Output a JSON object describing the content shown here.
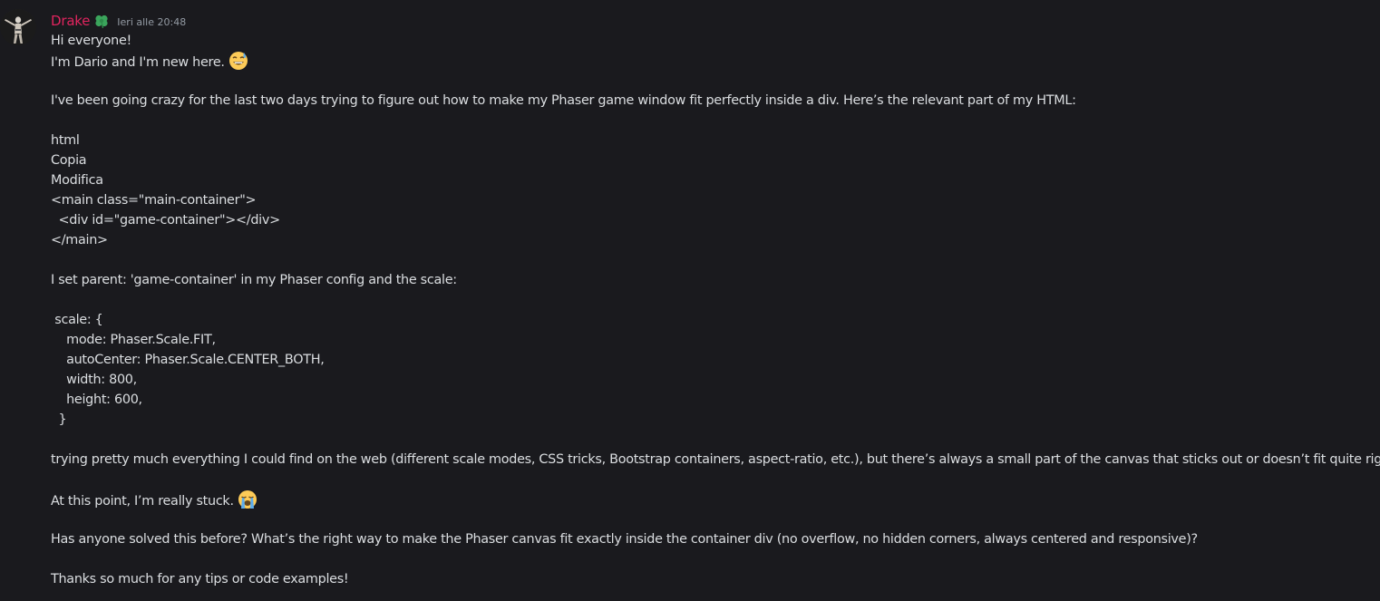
{
  "message": {
    "author": {
      "name": "Drake",
      "name_color": "#e0245e",
      "role_icon": "green-clover-icon",
      "avatar": "avatar-image"
    },
    "timestamp": "Ieri alle 20:48",
    "lines": {
      "l1": "Hi everyone!",
      "l2": "I'm Dario and I'm new here.",
      "l2_emoji": "grinning-sweat-emoji",
      "l4": "I've been going crazy for the last two days trying to figure out how to make my Phaser game window fit perfectly inside a div. Here’s the relevant part of my HTML:",
      "l6": "html",
      "l7": "Copia",
      "l8": "Modifica",
      "l9": "<main class=\"main-container\">",
      "l10": "  <div id=\"game-container\"></div>",
      "l11": "</main>",
      "l13": "I set parent: 'game-container' in my Phaser config and the scale:",
      "l15": " scale: {",
      "l16": "    mode: Phaser.Scale.FIT,",
      "l17": "    autoCenter: Phaser.Scale.CENTER_BOTH,",
      "l18": "    width: 800,",
      "l19": "    height: 600,",
      "l20": "  }",
      "l22": "trying pretty much everything I could find on the web (different scale modes, CSS tricks, Bootstrap containers, aspect-ratio, etc.), but there’s always a small part of the canvas that sticks out or doesn’t fit quite right.",
      "l24": "At this point, I’m really stuck.",
      "l24_emoji": "loudly-crying-emoji",
      "l26": "Has anyone solved this before? What’s the right way to make the Phaser canvas fit exactly inside the container div (no overflow, no hidden corners, always centered and responsive)?",
      "l28": "Thanks so much for any tips or code examples!"
    }
  }
}
